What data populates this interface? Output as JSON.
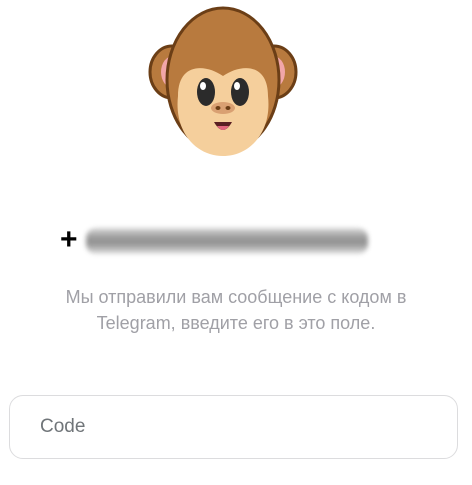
{
  "sticker": {
    "icon": "monkey-face-icon"
  },
  "phone": {
    "prefix": "+"
  },
  "message": {
    "line1": "Мы отправили вам сообщение с кодом в",
    "line2": "Telegram, введите его в это поле."
  },
  "code_input": {
    "placeholder": "Code",
    "value": ""
  },
  "colors": {
    "text_secondary": "#a0a0a6",
    "border": "#dcdcde",
    "monkey_fur": "#b87a3e",
    "monkey_face": "#f5cf9c"
  }
}
